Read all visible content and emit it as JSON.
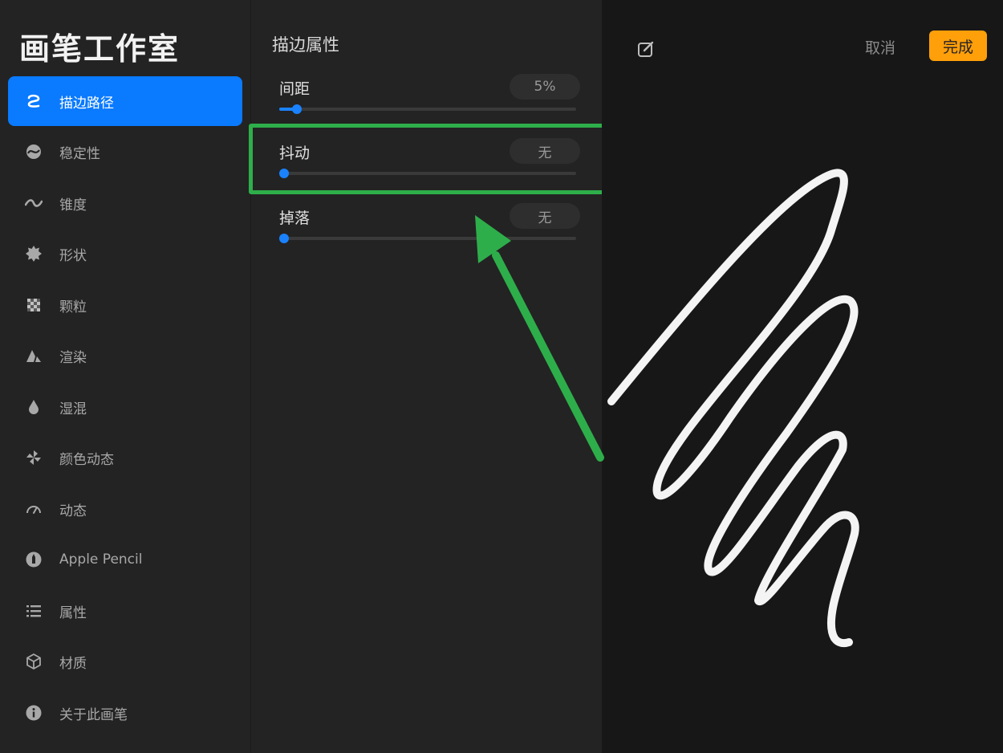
{
  "sidebar": {
    "title": "画笔工作室",
    "items": [
      {
        "label": "描边路径",
        "icon": "stroke-path-icon",
        "active": true
      },
      {
        "label": "稳定性",
        "icon": "stabilization-icon"
      },
      {
        "label": "锥度",
        "icon": "taper-icon"
      },
      {
        "label": "形状",
        "icon": "shape-icon"
      },
      {
        "label": "颗粒",
        "icon": "grain-icon"
      },
      {
        "label": "渲染",
        "icon": "rendering-icon"
      },
      {
        "label": "湿混",
        "icon": "wet-mix-icon"
      },
      {
        "label": "颜色动态",
        "icon": "color-dynamics-icon"
      },
      {
        "label": "动态",
        "icon": "dynamics-icon"
      },
      {
        "label": "Apple Pencil",
        "icon": "apple-pencil-icon"
      },
      {
        "label": "属性",
        "icon": "properties-icon"
      },
      {
        "label": "材质",
        "icon": "materials-icon"
      },
      {
        "label": "关于此画笔",
        "icon": "info-icon"
      }
    ]
  },
  "panel": {
    "title": "描边属性",
    "settings": [
      {
        "label": "间距",
        "value": "5%",
        "level": 0.06
      },
      {
        "label": "抖动",
        "value": "无",
        "level": 0
      },
      {
        "label": "掉落",
        "value": "无",
        "level": 0
      }
    ]
  },
  "header": {
    "cancel_label": "取消",
    "done_label": "完成"
  },
  "colors": {
    "accent": "#0a7aff",
    "done": "#ff9f0a",
    "highlight": "#2eae4a"
  }
}
